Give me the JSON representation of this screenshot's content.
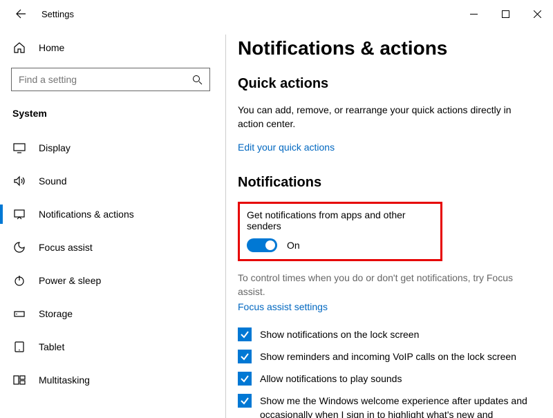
{
  "titlebar": {
    "title": "Settings"
  },
  "sidebar": {
    "home": "Home",
    "search_placeholder": "Find a setting",
    "category": "System",
    "items": [
      {
        "label": "Display"
      },
      {
        "label": "Sound"
      },
      {
        "label": "Notifications & actions"
      },
      {
        "label": "Focus assist"
      },
      {
        "label": "Power & sleep"
      },
      {
        "label": "Storage"
      },
      {
        "label": "Tablet"
      },
      {
        "label": "Multitasking"
      }
    ]
  },
  "main": {
    "title": "Notifications & actions",
    "quick": {
      "heading": "Quick actions",
      "body": "You can add, remove, or rearrange your quick actions directly in action center.",
      "link": "Edit your quick actions"
    },
    "notif": {
      "heading": "Notifications",
      "toggle_label": "Get notifications from apps and other senders",
      "toggle_state": "On",
      "tip": "To control times when you do or don't get notifications, try Focus assist.",
      "tip_link": "Focus assist settings",
      "checkboxes": [
        "Show notifications on the lock screen",
        "Show reminders and incoming VoIP calls on the lock screen",
        "Allow notifications to play sounds",
        "Show me the Windows welcome experience after updates and occasionally when I sign in to highlight what's new and"
      ]
    }
  }
}
